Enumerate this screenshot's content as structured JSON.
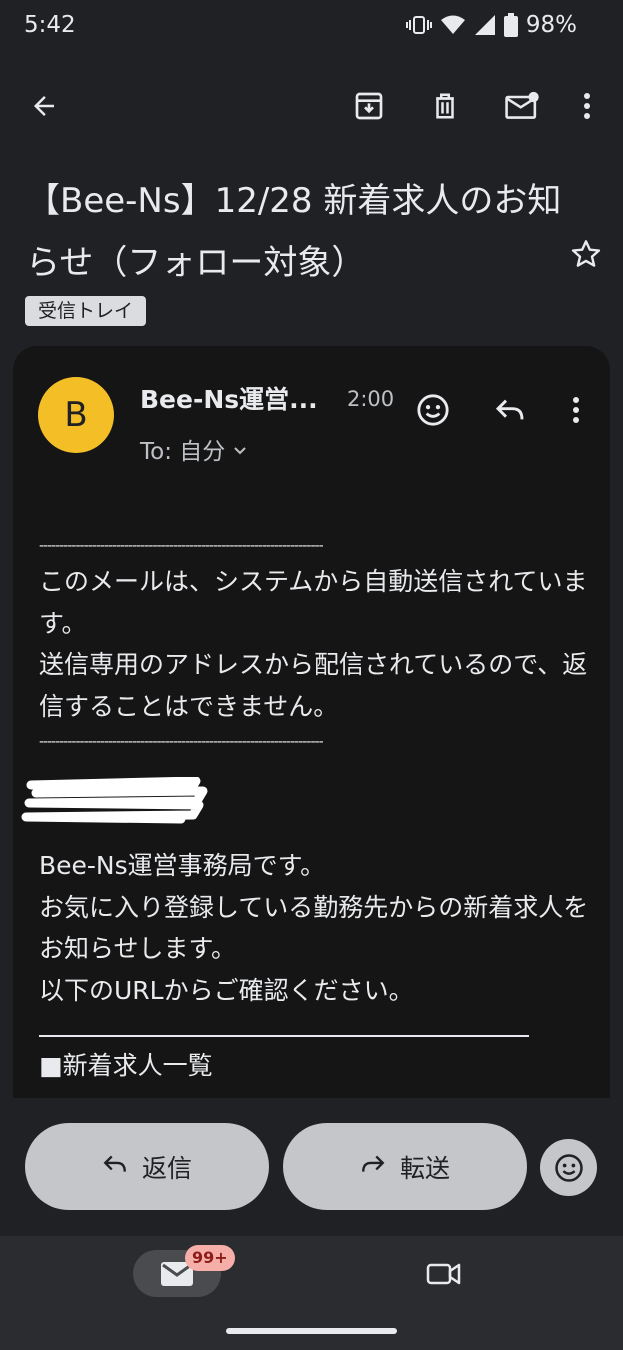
{
  "status": {
    "time": "5:42",
    "battery": "98%"
  },
  "email": {
    "subject": "【Bee-Ns】12/28 新着求人のお知らせ（フォロー対象）",
    "label": "受信トレイ",
    "sender_initial": "B",
    "sender": "Bee-Ns運営...",
    "time": "2:00",
    "to": "To: 自分",
    "dashes": "----------------------------------------------------------------------",
    "notice_1": "このメールは、システムから自動送信されています。",
    "notice_2": "送信専用のアドレスから配信されているので、返信することはできません。",
    "intro_1": "Bee-Ns運営事務局です。",
    "intro_2": "お気に入り登録している勤務先からの新着求人をお知らせします。",
    "intro_3": "以下のURLからご確認ください。",
    "section_heading": "■新着求人一覧"
  },
  "actions": {
    "reply": "返信",
    "forward": "転送"
  },
  "nav": {
    "mail_badge": "99+"
  },
  "icons": [
    "back-arrow-icon",
    "archive-icon",
    "trash-icon",
    "mark-unread-icon",
    "more-vert-icon",
    "star-icon",
    "emoji-icon",
    "reply-icon",
    "forward-icon",
    "mail-icon",
    "video-icon"
  ],
  "colors": {
    "background": "#202124",
    "card": "#151515",
    "avatar": "#f4bf26",
    "button": "#c5c6c9",
    "badge": "#f6aea9"
  }
}
